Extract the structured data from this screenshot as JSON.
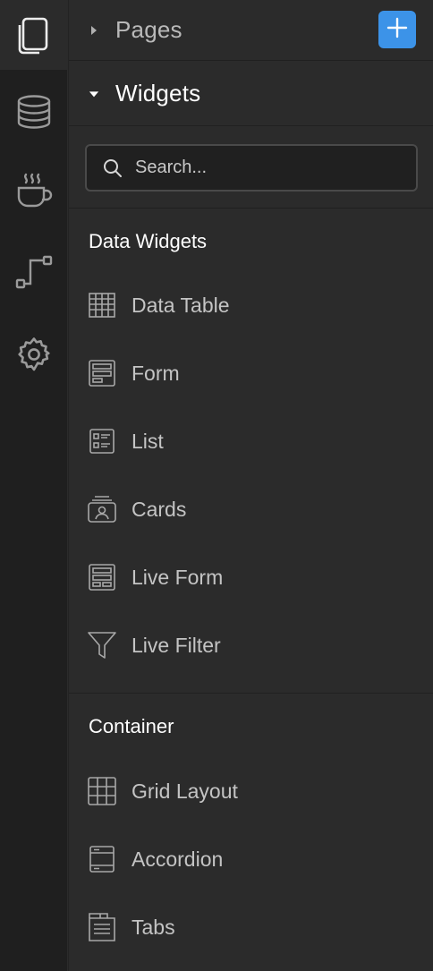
{
  "rail": {
    "items": [
      {
        "icon": "pages-icon",
        "active": true
      },
      {
        "icon": "database-icon",
        "active": false
      },
      {
        "icon": "coffee-cup-icon",
        "active": false
      },
      {
        "icon": "flow-icon",
        "active": false
      },
      {
        "icon": "gear-icon",
        "active": false
      }
    ]
  },
  "pages": {
    "title": "Pages",
    "add_label": "+"
  },
  "widgets": {
    "title": "Widgets",
    "search_placeholder": "Search...",
    "search_value": "",
    "groups": [
      {
        "title": "Data Widgets",
        "items": [
          {
            "label": "Data Table",
            "icon": "data-table-icon"
          },
          {
            "label": "Form",
            "icon": "form-icon"
          },
          {
            "label": "List",
            "icon": "list-icon"
          },
          {
            "label": "Cards",
            "icon": "cards-icon"
          },
          {
            "label": "Live Form",
            "icon": "live-form-icon"
          },
          {
            "label": "Live Filter",
            "icon": "filter-icon"
          }
        ]
      },
      {
        "title": "Container",
        "items": [
          {
            "label": "Grid Layout",
            "icon": "grid-layout-icon"
          },
          {
            "label": "Accordion",
            "icon": "accordion-icon"
          },
          {
            "label": "Tabs",
            "icon": "tabs-icon"
          }
        ]
      }
    ]
  },
  "colors": {
    "rail_bg": "#1f1f1f",
    "panel_bg": "#2b2b2b",
    "accent": "#3c93e8",
    "icon": "#a8a8a8",
    "text": "#c4c4c4"
  }
}
